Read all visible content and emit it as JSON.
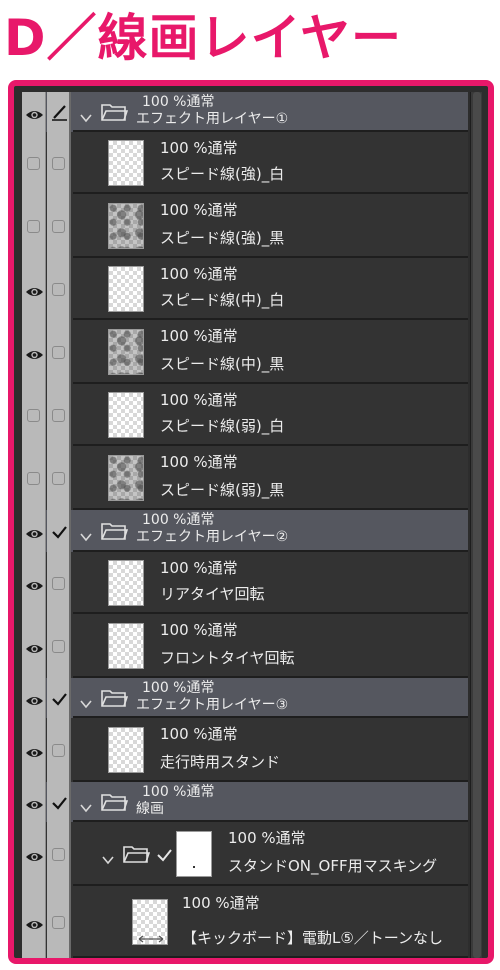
{
  "heading": "D／線画レイヤー",
  "layers": [
    {
      "kind": "folder",
      "visible": true,
      "lock_icon": "pen-icon",
      "info": "100 %通常",
      "name": "エフェクト用レイヤー①"
    },
    {
      "kind": "layer",
      "visible": false,
      "thumb": "checker",
      "info": "100 %通常",
      "name": "スピード線(強)_白"
    },
    {
      "kind": "layer",
      "visible": false,
      "thumb": "dark",
      "info": "100 %通常",
      "name": "スピード線(強)_黒"
    },
    {
      "kind": "layer",
      "visible": true,
      "thumb": "checker",
      "info": "100 %通常",
      "name": "スピード線(中)_白"
    },
    {
      "kind": "layer",
      "visible": true,
      "thumb": "dark",
      "info": "100 %通常",
      "name": "スピード線(中)_黒"
    },
    {
      "kind": "layer",
      "visible": false,
      "thumb": "checker",
      "info": "100 %通常",
      "name": "スピード線(弱)_白"
    },
    {
      "kind": "layer",
      "visible": false,
      "thumb": "dark",
      "info": "100 %通常",
      "name": "スピード線(弱)_黒"
    },
    {
      "kind": "folder",
      "visible": true,
      "lock_icon": "check-icon",
      "info": "100 %通常",
      "name": "エフェクト用レイヤー②"
    },
    {
      "kind": "layer",
      "visible": true,
      "thumb": "checker",
      "info": "100 %通常",
      "name": "リアタイヤ回転"
    },
    {
      "kind": "layer",
      "visible": true,
      "thumb": "checker",
      "info": "100 %通常",
      "name": "フロントタイヤ回転"
    },
    {
      "kind": "folder",
      "visible": true,
      "lock_icon": "check-icon",
      "info": "100 %通常",
      "name": "エフェクト用レイヤー③"
    },
    {
      "kind": "layer",
      "visible": true,
      "thumb": "checker",
      "info": "100 %通常",
      "name": "走行時用スタンド"
    },
    {
      "kind": "folder",
      "visible": true,
      "lock_icon": "check-icon",
      "info": "100 %通常",
      "name": "線画"
    },
    {
      "kind": "subfolder",
      "visible": true,
      "thumb": "plain",
      "info": "100 %通常",
      "name": "スタンドON_OFF用マスキング"
    },
    {
      "kind": "sublayer",
      "visible": true,
      "thumb": "checker",
      "info": "100 %通常",
      "name": "【キックボード】電動L⑤／トーンなし"
    }
  ]
}
